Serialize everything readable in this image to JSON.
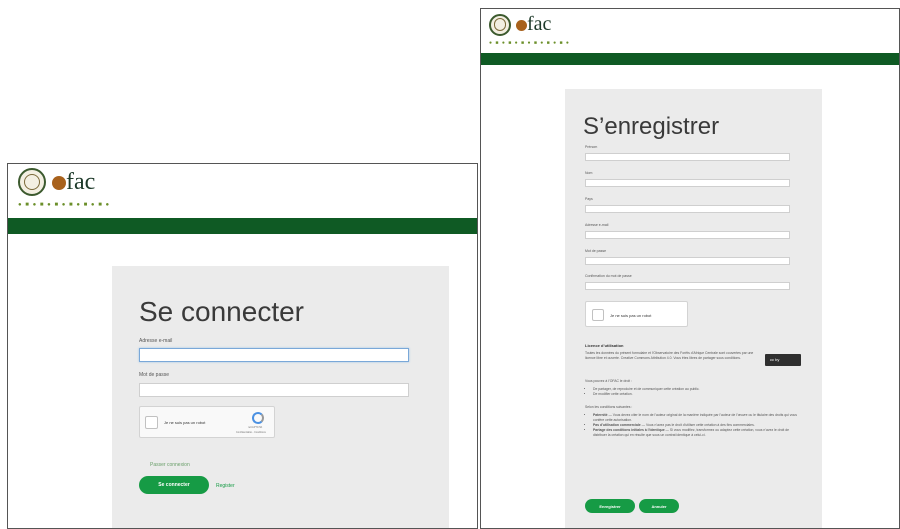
{
  "login": {
    "brand": "fac",
    "tagline": "● ■ ● ■ ● ■ ● ■ ● ■ ● ■ ●",
    "title": "Se connecter",
    "email_label": "Adresse e-mail",
    "password_label": "Mot de passe",
    "recaptcha": {
      "label": "Je ne suis pas un robot",
      "brand": "reCAPTCHA",
      "terms": "Confidentialité - Conditions"
    },
    "forgot_link": "Passer connexion",
    "submit_label": "Se connecter",
    "register_link": "Register",
    "colors": {
      "bar": "#0f5a24",
      "button": "#169b45",
      "card": "#ebebeb"
    }
  },
  "register": {
    "brand": "fac",
    "tagline": "● ■ ● ■ ● ■ ● ■ ● ■ ● ■ ●",
    "title": "S’enregistrer",
    "fields": [
      {
        "label": "Prénom"
      },
      {
        "label": "Nom"
      },
      {
        "label": "Pays"
      },
      {
        "label": "Adresse e-mail"
      },
      {
        "label": "Mot de passe"
      },
      {
        "label": "Confirmation du mot de passe"
      }
    ],
    "recaptcha_label": "Je ne suis pas un robot",
    "license": {
      "heading": "Licence d’utilisation",
      "body": "Toutes les données du présent formulaire et l’Observatoire des Forêts d’Afrique Centrale sont couvertes par une licence libre et ouverte. Creative Commons Attribution 4.0. Vous êtes libres de partager sous conditions.",
      "cc_badge": "cc by",
      "allowed_heading": "Vous pouvez à l’OFAC le droit :",
      "allowed": [
        "De partager, de reproduire et de communiquer cette création au public.",
        "De modifier cette création."
      ],
      "conditions_heading": "Selon les conditions suivantes :",
      "conditions": [
        {
          "bold": "Paternité",
          "text": " — Vous devez citer le nom de l’auteur original de la manière indiquée par l’auteur de l’œuvre ou le titulaire des droits qui vous confère cette autorisation."
        },
        {
          "bold": "Pas d’utilisation commerciale",
          "text": " — Vous n’avez pas le droit d’utiliser cette création à des fins commerciales."
        },
        {
          "bold": "Partage des conditions initiales à l’identique",
          "text": " — Si vous modifiez, transformez ou adaptez cette création, vous n’avez le droit de distribuer la création qui en résulte que sous un contrat identique à celui-ci."
        }
      ]
    },
    "submit_label": "Enregistrer",
    "cancel_label": "Annuler"
  }
}
